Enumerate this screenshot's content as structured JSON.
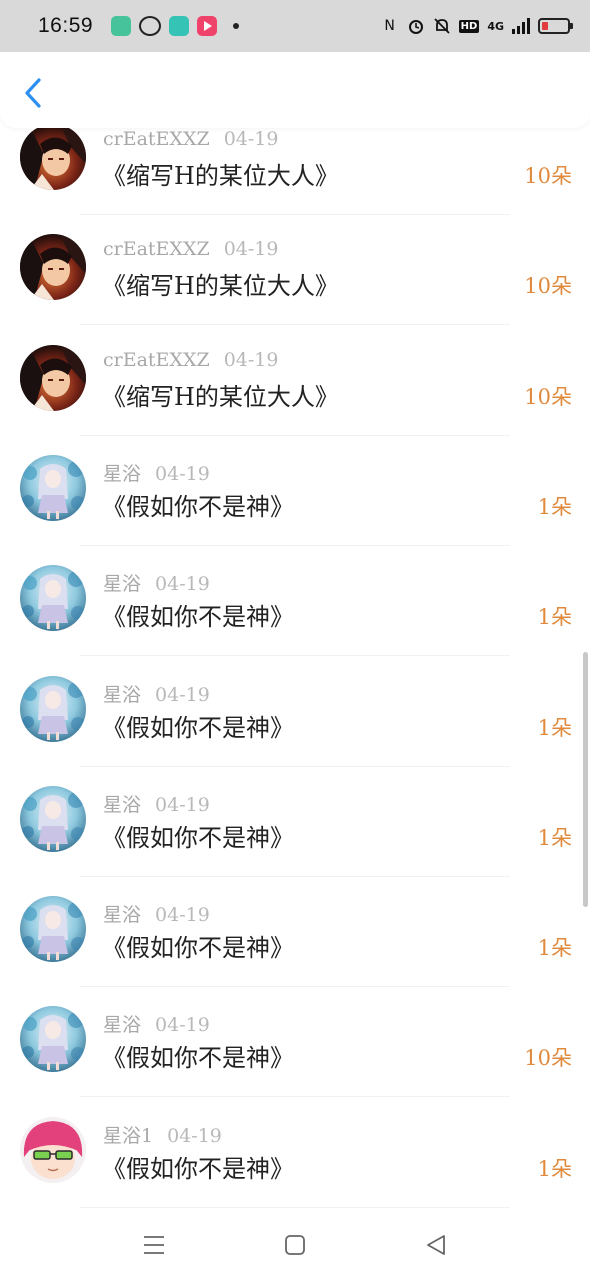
{
  "status_bar": {
    "time": "16:59",
    "hd_label": "HD",
    "signal_label": "4G"
  },
  "colors": {
    "count_accent": "#e08a3d",
    "back_arrow": "#2d8ff0",
    "status_bg": "#d9d9d9"
  },
  "icons": {
    "back": "chevron-left-icon",
    "menu": "menu-icon",
    "home": "home-square-icon",
    "back_nav": "triangle-back-icon"
  },
  "rows": [
    {
      "user": "crEatEXXZ",
      "date": "04-19",
      "title": "《缩写H的某位大人》",
      "count": "10朵",
      "avatar": "avatar-dark-hero"
    },
    {
      "user": "crEatEXXZ",
      "date": "04-19",
      "title": "《缩写H的某位大人》",
      "count": "10朵",
      "avatar": "avatar-dark-hero"
    },
    {
      "user": "crEatEXXZ",
      "date": "04-19",
      "title": "《缩写H的某位大人》",
      "count": "10朵",
      "avatar": "avatar-dark-hero"
    },
    {
      "user": "星浴",
      "date": "04-19",
      "title": "《假如你不是神》",
      "count": "1朵",
      "avatar": "avatar-blue-girl"
    },
    {
      "user": "星浴",
      "date": "04-19",
      "title": "《假如你不是神》",
      "count": "1朵",
      "avatar": "avatar-blue-girl"
    },
    {
      "user": "星浴",
      "date": "04-19",
      "title": "《假如你不是神》",
      "count": "1朵",
      "avatar": "avatar-blue-girl"
    },
    {
      "user": "星浴",
      "date": "04-19",
      "title": "《假如你不是神》",
      "count": "1朵",
      "avatar": "avatar-blue-girl"
    },
    {
      "user": "星浴",
      "date": "04-19",
      "title": "《假如你不是神》",
      "count": "1朵",
      "avatar": "avatar-blue-girl"
    },
    {
      "user": "星浴",
      "date": "04-19",
      "title": "《假如你不是神》",
      "count": "10朵",
      "avatar": "avatar-blue-girl"
    },
    {
      "user": "星浴1",
      "date": "04-19",
      "title": "《假如你不是神》",
      "count": "1朵",
      "avatar": "avatar-pink-hair"
    }
  ]
}
